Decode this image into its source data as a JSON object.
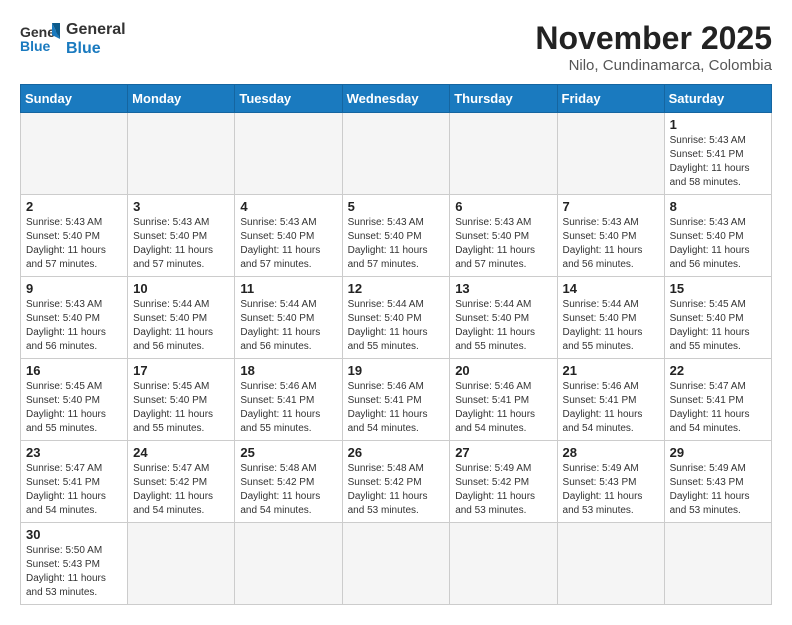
{
  "header": {
    "logo_general": "General",
    "logo_blue": "Blue",
    "month_title": "November 2025",
    "location": "Nilo, Cundinamarca, Colombia"
  },
  "weekdays": [
    "Sunday",
    "Monday",
    "Tuesday",
    "Wednesday",
    "Thursday",
    "Friday",
    "Saturday"
  ],
  "days": {
    "1": {
      "sunrise": "5:43 AM",
      "sunset": "5:41 PM",
      "daylight": "11 hours and 58 minutes."
    },
    "2": {
      "sunrise": "5:43 AM",
      "sunset": "5:40 PM",
      "daylight": "11 hours and 57 minutes."
    },
    "3": {
      "sunrise": "5:43 AM",
      "sunset": "5:40 PM",
      "daylight": "11 hours and 57 minutes."
    },
    "4": {
      "sunrise": "5:43 AM",
      "sunset": "5:40 PM",
      "daylight": "11 hours and 57 minutes."
    },
    "5": {
      "sunrise": "5:43 AM",
      "sunset": "5:40 PM",
      "daylight": "11 hours and 57 minutes."
    },
    "6": {
      "sunrise": "5:43 AM",
      "sunset": "5:40 PM",
      "daylight": "11 hours and 57 minutes."
    },
    "7": {
      "sunrise": "5:43 AM",
      "sunset": "5:40 PM",
      "daylight": "11 hours and 56 minutes."
    },
    "8": {
      "sunrise": "5:43 AM",
      "sunset": "5:40 PM",
      "daylight": "11 hours and 56 minutes."
    },
    "9": {
      "sunrise": "5:43 AM",
      "sunset": "5:40 PM",
      "daylight": "11 hours and 56 minutes."
    },
    "10": {
      "sunrise": "5:44 AM",
      "sunset": "5:40 PM",
      "daylight": "11 hours and 56 minutes."
    },
    "11": {
      "sunrise": "5:44 AM",
      "sunset": "5:40 PM",
      "daylight": "11 hours and 56 minutes."
    },
    "12": {
      "sunrise": "5:44 AM",
      "sunset": "5:40 PM",
      "daylight": "11 hours and 55 minutes."
    },
    "13": {
      "sunrise": "5:44 AM",
      "sunset": "5:40 PM",
      "daylight": "11 hours and 55 minutes."
    },
    "14": {
      "sunrise": "5:44 AM",
      "sunset": "5:40 PM",
      "daylight": "11 hours and 55 minutes."
    },
    "15": {
      "sunrise": "5:45 AM",
      "sunset": "5:40 PM",
      "daylight": "11 hours and 55 minutes."
    },
    "16": {
      "sunrise": "5:45 AM",
      "sunset": "5:40 PM",
      "daylight": "11 hours and 55 minutes."
    },
    "17": {
      "sunrise": "5:45 AM",
      "sunset": "5:40 PM",
      "daylight": "11 hours and 55 minutes."
    },
    "18": {
      "sunrise": "5:46 AM",
      "sunset": "5:41 PM",
      "daylight": "11 hours and 55 minutes."
    },
    "19": {
      "sunrise": "5:46 AM",
      "sunset": "5:41 PM",
      "daylight": "11 hours and 54 minutes."
    },
    "20": {
      "sunrise": "5:46 AM",
      "sunset": "5:41 PM",
      "daylight": "11 hours and 54 minutes."
    },
    "21": {
      "sunrise": "5:46 AM",
      "sunset": "5:41 PM",
      "daylight": "11 hours and 54 minutes."
    },
    "22": {
      "sunrise": "5:47 AM",
      "sunset": "5:41 PM",
      "daylight": "11 hours and 54 minutes."
    },
    "23": {
      "sunrise": "5:47 AM",
      "sunset": "5:41 PM",
      "daylight": "11 hours and 54 minutes."
    },
    "24": {
      "sunrise": "5:47 AM",
      "sunset": "5:42 PM",
      "daylight": "11 hours and 54 minutes."
    },
    "25": {
      "sunrise": "5:48 AM",
      "sunset": "5:42 PM",
      "daylight": "11 hours and 54 minutes."
    },
    "26": {
      "sunrise": "5:48 AM",
      "sunset": "5:42 PM",
      "daylight": "11 hours and 53 minutes."
    },
    "27": {
      "sunrise": "5:49 AM",
      "sunset": "5:42 PM",
      "daylight": "11 hours and 53 minutes."
    },
    "28": {
      "sunrise": "5:49 AM",
      "sunset": "5:43 PM",
      "daylight": "11 hours and 53 minutes."
    },
    "29": {
      "sunrise": "5:49 AM",
      "sunset": "5:43 PM",
      "daylight": "11 hours and 53 minutes."
    },
    "30": {
      "sunrise": "5:50 AM",
      "sunset": "5:43 PM",
      "daylight": "11 hours and 53 minutes."
    }
  },
  "labels": {
    "sunrise": "Sunrise:",
    "sunset": "Sunset:",
    "daylight": "Daylight:"
  }
}
